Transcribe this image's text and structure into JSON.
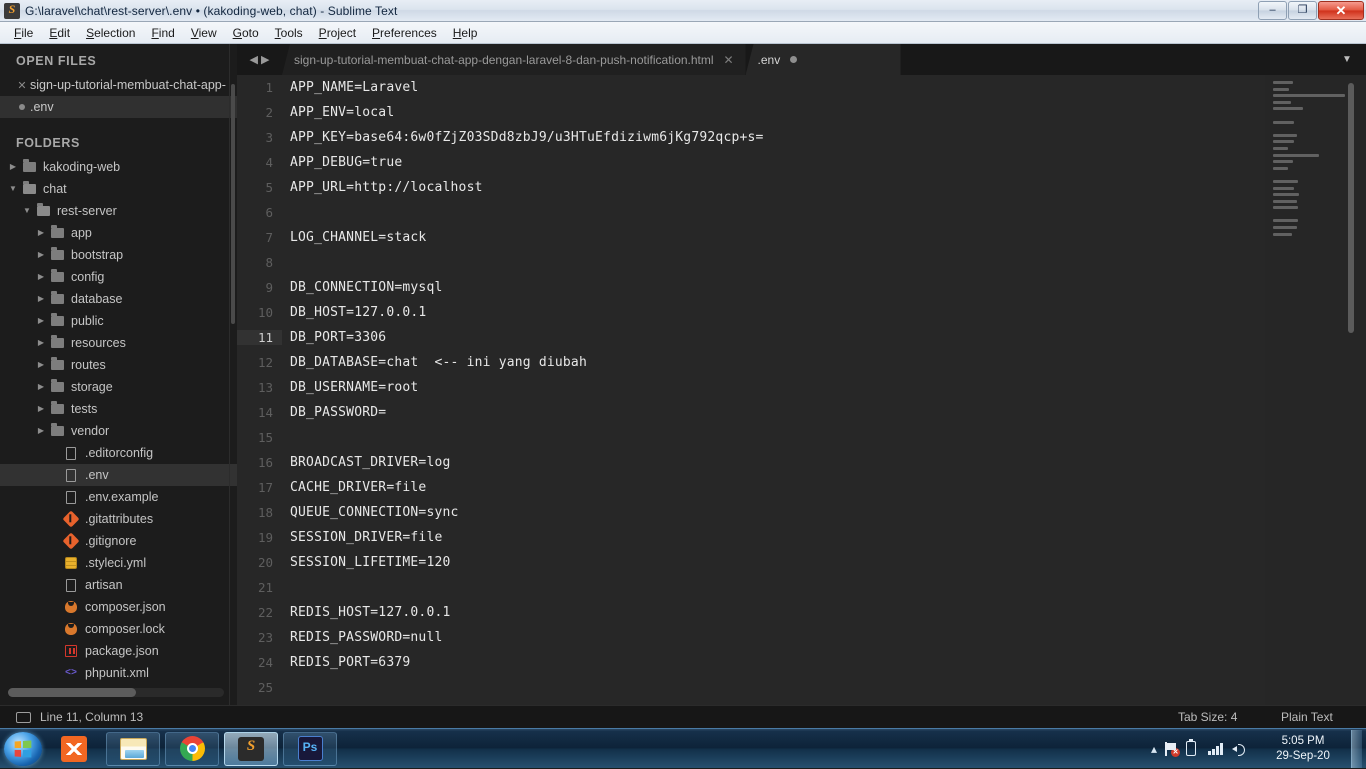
{
  "window": {
    "title": "G:\\laravel\\chat\\rest-server\\.env • (kakoding-web, chat) - Sublime Text",
    "app_icon": "sublime-text-icon",
    "minimize": "–",
    "restore": "❐",
    "close": "✕"
  },
  "menubar": {
    "items": [
      {
        "label": "File"
      },
      {
        "label": "Edit"
      },
      {
        "label": "Selection"
      },
      {
        "label": "Find"
      },
      {
        "label": "View"
      },
      {
        "label": "Goto"
      },
      {
        "label": "Tools"
      },
      {
        "label": "Project"
      },
      {
        "label": "Preferences"
      },
      {
        "label": "Help"
      }
    ]
  },
  "sidebar": {
    "open_files_header": "OPEN FILES",
    "open_files": [
      {
        "label": "sign-up-tutorial-membuat-chat-app-",
        "mark": "close-icon",
        "selected": false
      },
      {
        "label": ".env",
        "mark": "modified-dot-icon",
        "selected": true
      }
    ],
    "folders_header": "FOLDERS",
    "tree": [
      {
        "label": "kakoding-web",
        "type": "folder",
        "state": "collapsed",
        "indent": 1
      },
      {
        "label": "chat",
        "type": "folder",
        "state": "expanded",
        "indent": 1
      },
      {
        "label": "rest-server",
        "type": "folder",
        "state": "expanded",
        "indent": 2
      },
      {
        "label": "app",
        "type": "folder",
        "state": "collapsed",
        "indent": 3
      },
      {
        "label": "bootstrap",
        "type": "folder",
        "state": "collapsed",
        "indent": 3
      },
      {
        "label": "config",
        "type": "folder",
        "state": "collapsed",
        "indent": 3
      },
      {
        "label": "database",
        "type": "folder",
        "state": "collapsed",
        "indent": 3
      },
      {
        "label": "public",
        "type": "folder",
        "state": "collapsed",
        "indent": 3
      },
      {
        "label": "resources",
        "type": "folder",
        "state": "collapsed",
        "indent": 3
      },
      {
        "label": "routes",
        "type": "folder",
        "state": "collapsed",
        "indent": 3
      },
      {
        "label": "storage",
        "type": "folder",
        "state": "collapsed",
        "indent": 3
      },
      {
        "label": "tests",
        "type": "folder",
        "state": "collapsed",
        "indent": 3
      },
      {
        "label": "vendor",
        "type": "folder",
        "state": "collapsed",
        "indent": 3
      },
      {
        "label": ".editorconfig",
        "type": "file",
        "icon": "file-icon",
        "indent": 4
      },
      {
        "label": ".env",
        "type": "file",
        "icon": "file-icon",
        "indent": 4,
        "selected": true
      },
      {
        "label": ".env.example",
        "type": "file",
        "icon": "file-icon",
        "indent": 4
      },
      {
        "label": ".gitattributes",
        "type": "file",
        "icon": "git-icon",
        "indent": 4
      },
      {
        "label": ".gitignore",
        "type": "file",
        "icon": "git-icon",
        "indent": 4
      },
      {
        "label": ".styleci.yml",
        "type": "file",
        "icon": "yaml-database-icon",
        "indent": 4
      },
      {
        "label": "artisan",
        "type": "file",
        "icon": "file-icon",
        "indent": 4
      },
      {
        "label": "composer.json",
        "type": "file",
        "icon": "composer-icon",
        "indent": 4
      },
      {
        "label": "composer.lock",
        "type": "file",
        "icon": "composer-icon",
        "indent": 4
      },
      {
        "label": "package.json",
        "type": "file",
        "icon": "npm-icon",
        "indent": 4
      },
      {
        "label": "phpunit.xml",
        "type": "file",
        "icon": "xml-code-icon",
        "indent": 4
      }
    ]
  },
  "tabs": {
    "items": [
      {
        "label": "sign-up-tutorial-membuat-chat-app-dengan-laravel-8-dan-push-notification.html",
        "active": false,
        "close": "✕"
      },
      {
        "label": ".env",
        "active": true,
        "modified": true
      }
    ],
    "overflow_icon": "chevron-down-icon"
  },
  "editor": {
    "lines": [
      {
        "n": "1",
        "text": "APP_NAME=Laravel"
      },
      {
        "n": "2",
        "text": "APP_ENV=local"
      },
      {
        "n": "3",
        "text": "APP_KEY=base64:6w0fZjZ03SDd8zbJ9/u3HTuEfdiziwm6jKg792qcp+s="
      },
      {
        "n": "4",
        "text": "APP_DEBUG=true"
      },
      {
        "n": "5",
        "text": "APP_URL=http://localhost"
      },
      {
        "n": "6",
        "text": ""
      },
      {
        "n": "7",
        "text": "LOG_CHANNEL=stack"
      },
      {
        "n": "8",
        "text": ""
      },
      {
        "n": "9",
        "text": "DB_CONNECTION=mysql"
      },
      {
        "n": "10",
        "text": "DB_HOST=127.0.0.1"
      },
      {
        "n": "11",
        "text": "DB_PORT=3306",
        "cursor": true
      },
      {
        "n": "12",
        "text": "DB_DATABASE=chat  <-- ini yang diubah"
      },
      {
        "n": "13",
        "text": "DB_USERNAME=root"
      },
      {
        "n": "14",
        "text": "DB_PASSWORD="
      },
      {
        "n": "15",
        "text": ""
      },
      {
        "n": "16",
        "text": "BROADCAST_DRIVER=log"
      },
      {
        "n": "17",
        "text": "CACHE_DRIVER=file"
      },
      {
        "n": "18",
        "text": "QUEUE_CONNECTION=sync"
      },
      {
        "n": "19",
        "text": "SESSION_DRIVER=file"
      },
      {
        "n": "20",
        "text": "SESSION_LIFETIME=120"
      },
      {
        "n": "21",
        "text": ""
      },
      {
        "n": "22",
        "text": "REDIS_HOST=127.0.0.1"
      },
      {
        "n": "23",
        "text": "REDIS_PASSWORD=null"
      },
      {
        "n": "24",
        "text": "REDIS_PORT=6379"
      },
      {
        "n": "25",
        "text": ""
      }
    ]
  },
  "statusbar": {
    "monitor_icon": "monitor-icon",
    "position": "Line 11, Column 13",
    "tab_size": "Tab Size: 4",
    "syntax": "Plain Text"
  },
  "taskbar": {
    "start_icon": "windows-start-icon",
    "buttons": [
      {
        "name": "xampp",
        "icon": "xampp-icon",
        "active": false,
        "plain": true
      },
      {
        "name": "file-explorer",
        "icon": "folder-explorer-icon",
        "active": false
      },
      {
        "name": "google-chrome",
        "icon": "chrome-icon",
        "active": false
      },
      {
        "name": "sublime-text",
        "icon": "sublime-icon",
        "active": true
      },
      {
        "name": "photoshop",
        "icon": "photoshop-icon",
        "active": false
      }
    ],
    "tray": {
      "show_hidden_icon": "chevron-up-icon",
      "action_center_icon": "flag-alert-icon",
      "battery_icon": "battery-icon",
      "network_icon": "signal-bars-icon",
      "volume_icon": "speaker-icon"
    },
    "clock": {
      "time": "5:05 PM",
      "date": "29-Sep-20"
    }
  },
  "colors": {
    "accent_orange": "#f2a02e",
    "editor_bg": "#272727",
    "sidebar_bg": "#1c1c1c",
    "close_red": "#cf2f19"
  }
}
